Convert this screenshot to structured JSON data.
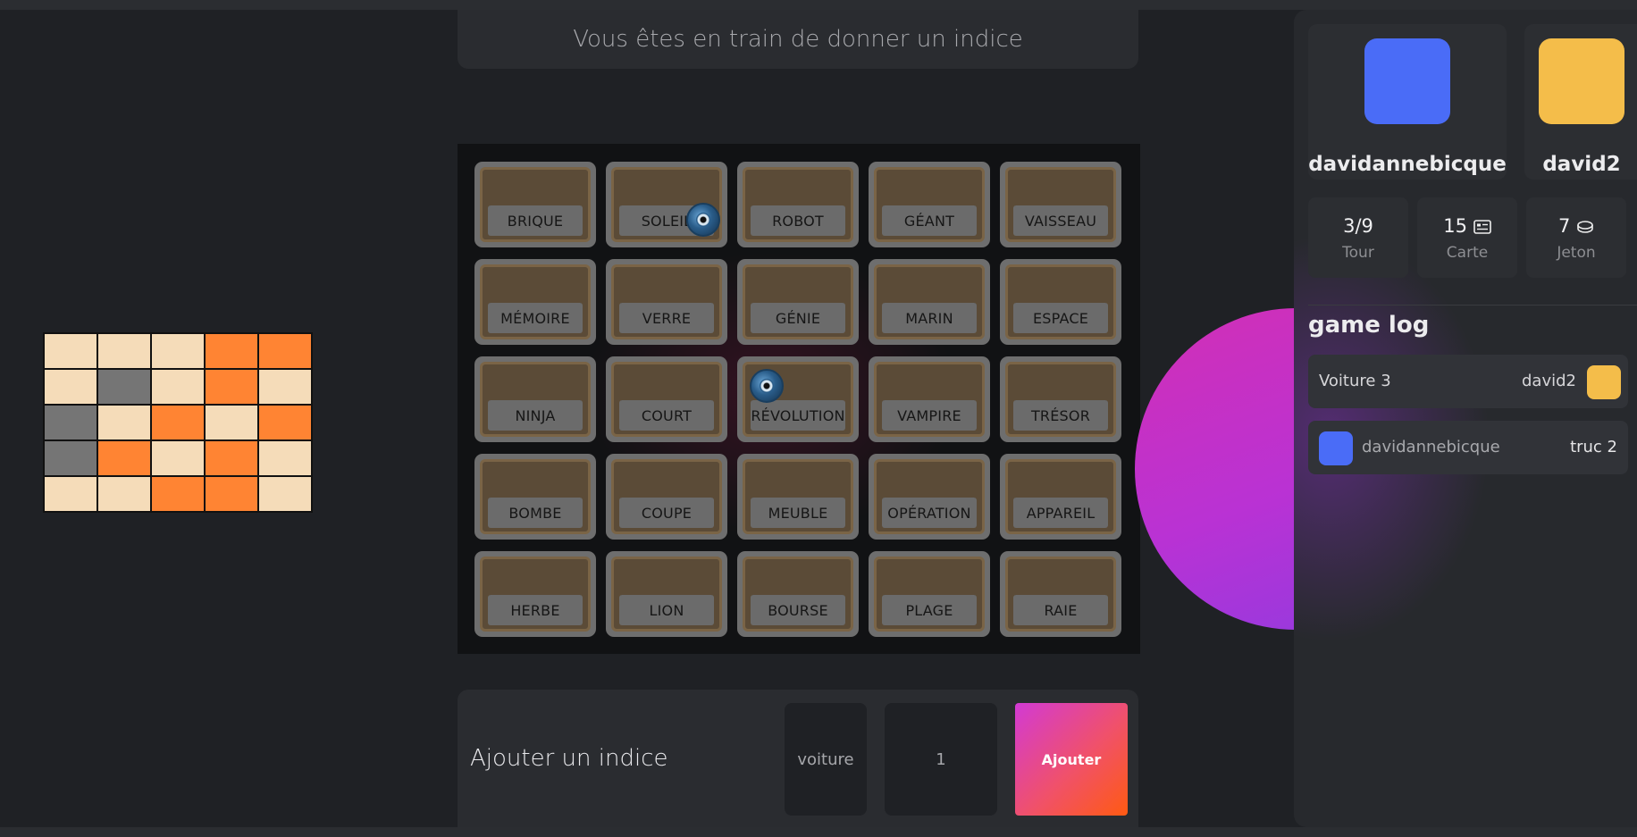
{
  "banner": {
    "status_text": "Vous êtes en train de donner un indice"
  },
  "colors": {
    "beige": "#f5dcb9",
    "orange": "#ff8433",
    "gray": "#757575",
    "player_blue": "#4a6cf7",
    "player_yellow": "#f4bd4a"
  },
  "key_grid": [
    [
      "beige",
      "beige",
      "beige",
      "orange",
      "orange"
    ],
    [
      "beige",
      "gray",
      "beige",
      "orange",
      "beige"
    ],
    [
      "gray",
      "beige",
      "orange",
      "beige",
      "orange"
    ],
    [
      "gray",
      "orange",
      "beige",
      "orange",
      "beige"
    ],
    [
      "beige",
      "beige",
      "orange",
      "orange",
      "beige"
    ]
  ],
  "board": {
    "cards": [
      {
        "word": "BRIQUE",
        "token": false
      },
      {
        "word": "SOLEIL",
        "token": true
      },
      {
        "word": "ROBOT",
        "token": false
      },
      {
        "word": "GÉANT",
        "token": false
      },
      {
        "word": "VAISSEAU",
        "token": false
      },
      {
        "word": "MÉMOIRE",
        "token": false
      },
      {
        "word": "VERRE",
        "token": false
      },
      {
        "word": "GÉNIE",
        "token": false
      },
      {
        "word": "MARIN",
        "token": false
      },
      {
        "word": "ESPACE",
        "token": false
      },
      {
        "word": "NINJA",
        "token": false
      },
      {
        "word": "COURT",
        "token": false
      },
      {
        "word": "RÉVOLUTION",
        "token": true
      },
      {
        "word": "VAMPIRE",
        "token": false
      },
      {
        "word": "TRÉSOR",
        "token": false
      },
      {
        "word": "BOMBE",
        "token": false
      },
      {
        "word": "COUPE",
        "token": false
      },
      {
        "word": "MEUBLE",
        "token": false
      },
      {
        "word": "OPÉRATION",
        "token": false
      },
      {
        "word": "APPAREIL",
        "token": false
      },
      {
        "word": "HERBE",
        "token": false
      },
      {
        "word": "LION",
        "token": false
      },
      {
        "word": "BOURSE",
        "token": false
      },
      {
        "word": "PLAGE",
        "token": false
      },
      {
        "word": "RAIE",
        "token": false
      }
    ]
  },
  "clue_form": {
    "title": "Ajouter un indice",
    "word_value": "voiture",
    "count_value": "1",
    "submit_label": "Ajouter"
  },
  "players": [
    {
      "name": "davidannebicque",
      "color": "player_blue"
    },
    {
      "name": "david2",
      "color": "player_yellow"
    }
  ],
  "stats": [
    {
      "value": "3/9",
      "label": "Tour",
      "icon": ""
    },
    {
      "value": "15",
      "label": "Carte",
      "icon": "card-icon"
    },
    {
      "value": "7",
      "label": "Jeton",
      "icon": "coin-icon"
    }
  ],
  "game_log": {
    "title": "game log",
    "entries": [
      {
        "clue": "Voiture 3",
        "player": "david2",
        "color": "player_yellow",
        "side": "right"
      },
      {
        "clue": "truc 2",
        "player": "davidannebicque",
        "color": "player_blue",
        "side": "left"
      }
    ]
  }
}
